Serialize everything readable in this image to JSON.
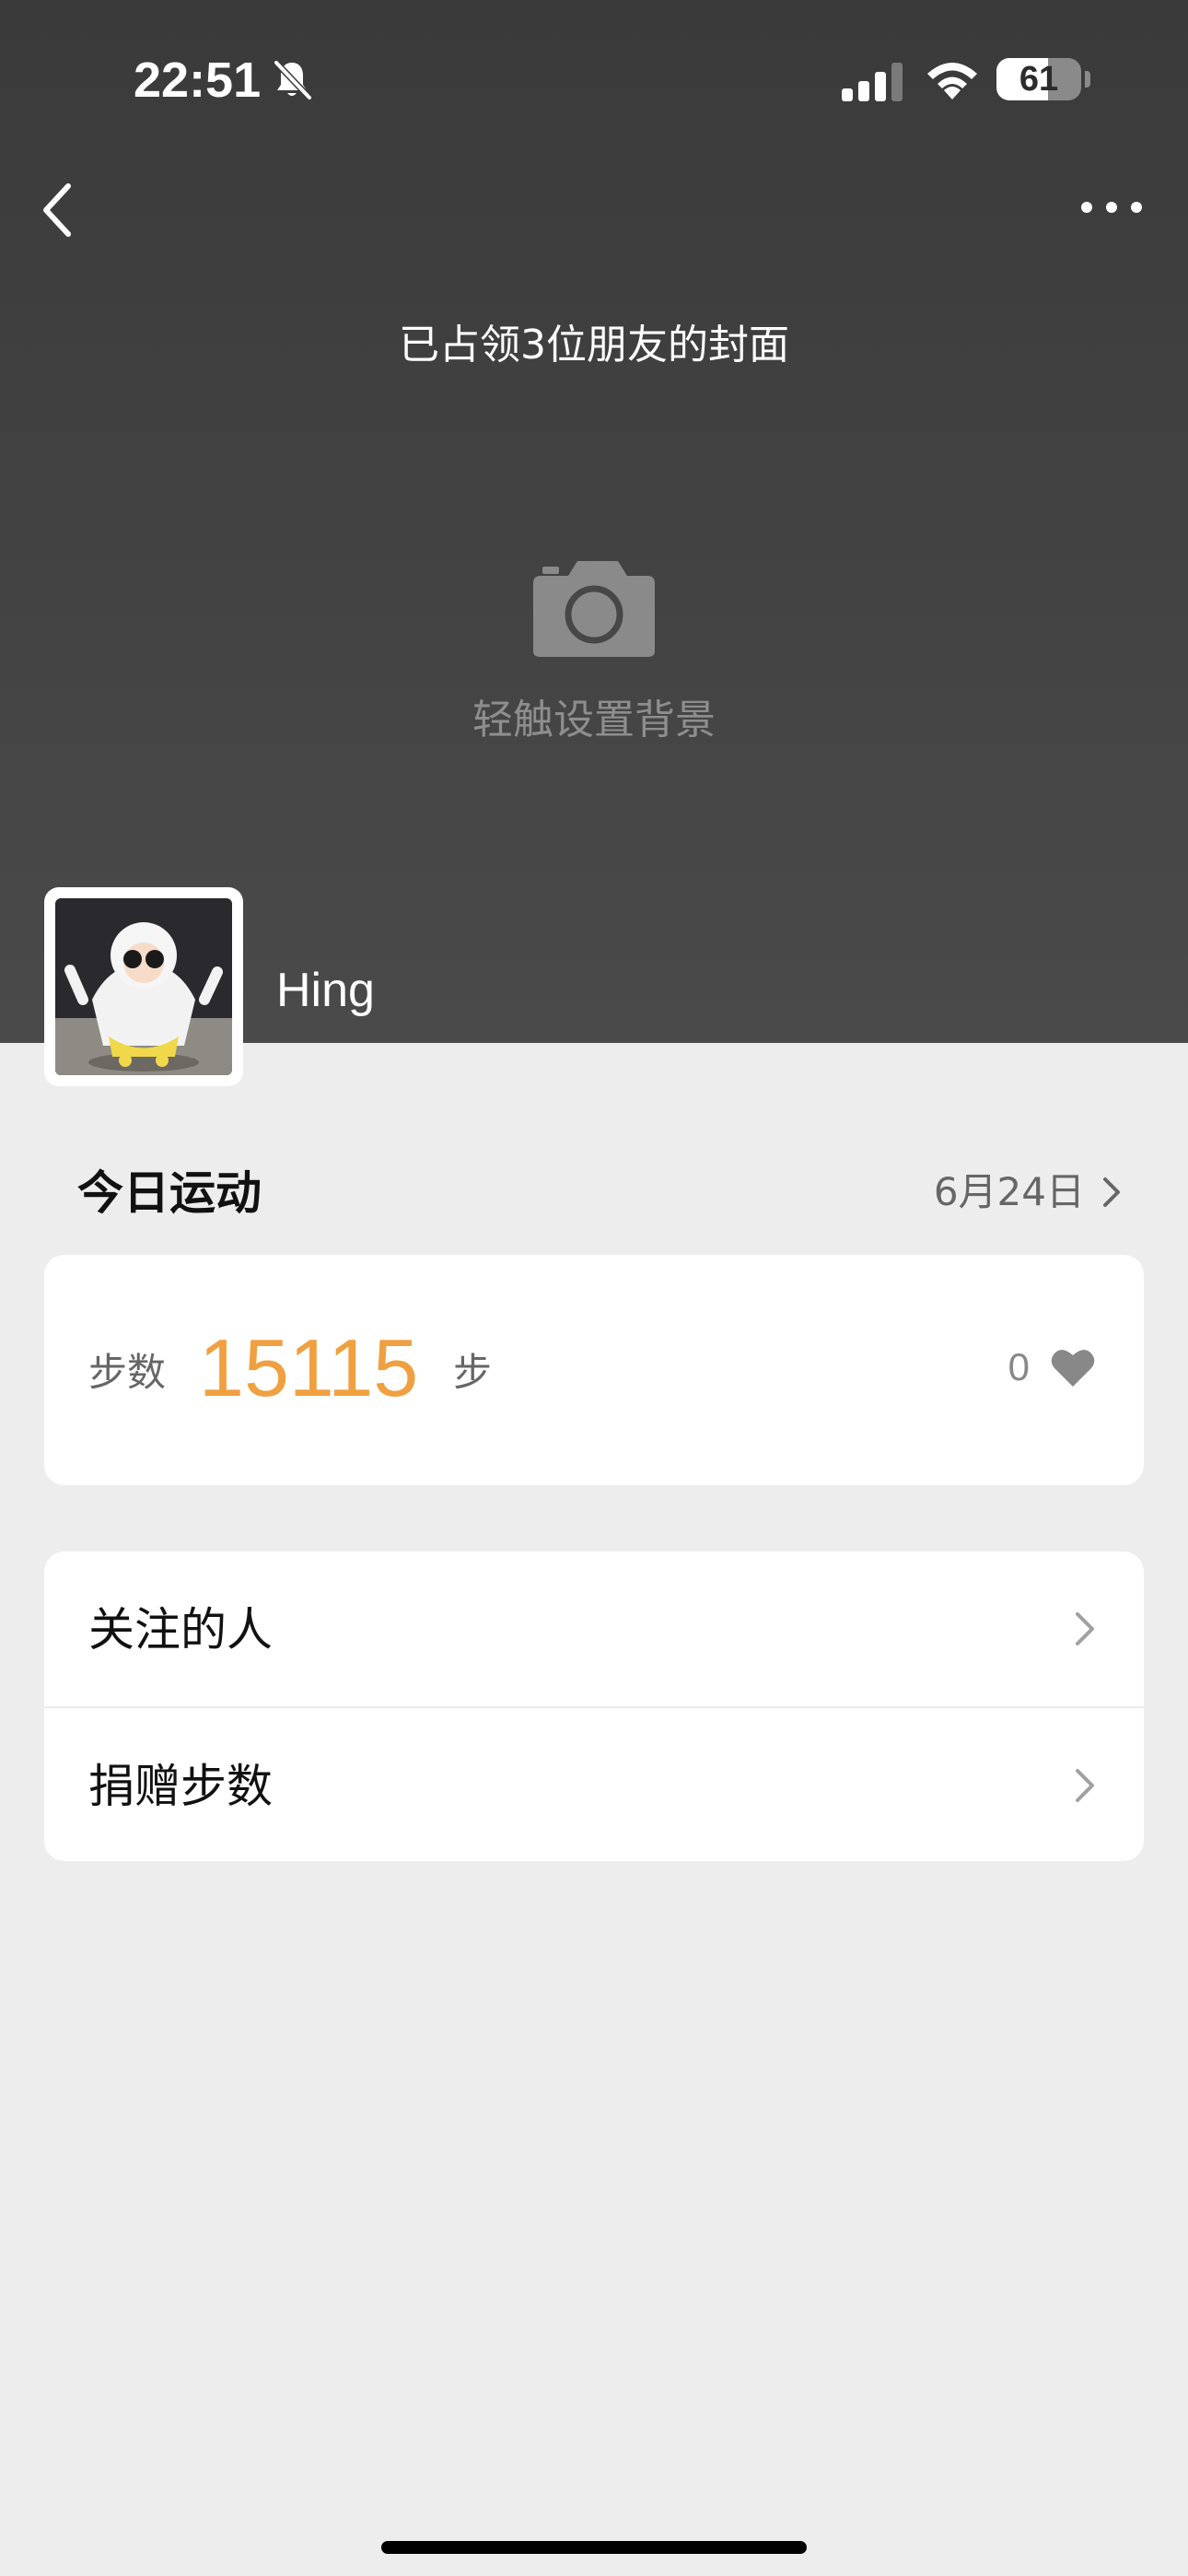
{
  "status_bar": {
    "time": "22:51",
    "battery": "61",
    "battery_level": 0.61
  },
  "header": {
    "occupy_text": "已占领3位朋友的封面",
    "set_background_text": "轻触设置背景"
  },
  "profile": {
    "username": "Hing"
  },
  "today": {
    "title": "今日运动",
    "date": "6月24日",
    "steps_label": "步数",
    "steps_value": "15115",
    "steps_unit": "步",
    "likes": "0"
  },
  "list": {
    "items": [
      {
        "label": "关注的人"
      },
      {
        "label": "捐赠步数"
      }
    ]
  },
  "colors": {
    "accent": "#f0a040",
    "cover": "#454545",
    "background": "#ededed"
  }
}
